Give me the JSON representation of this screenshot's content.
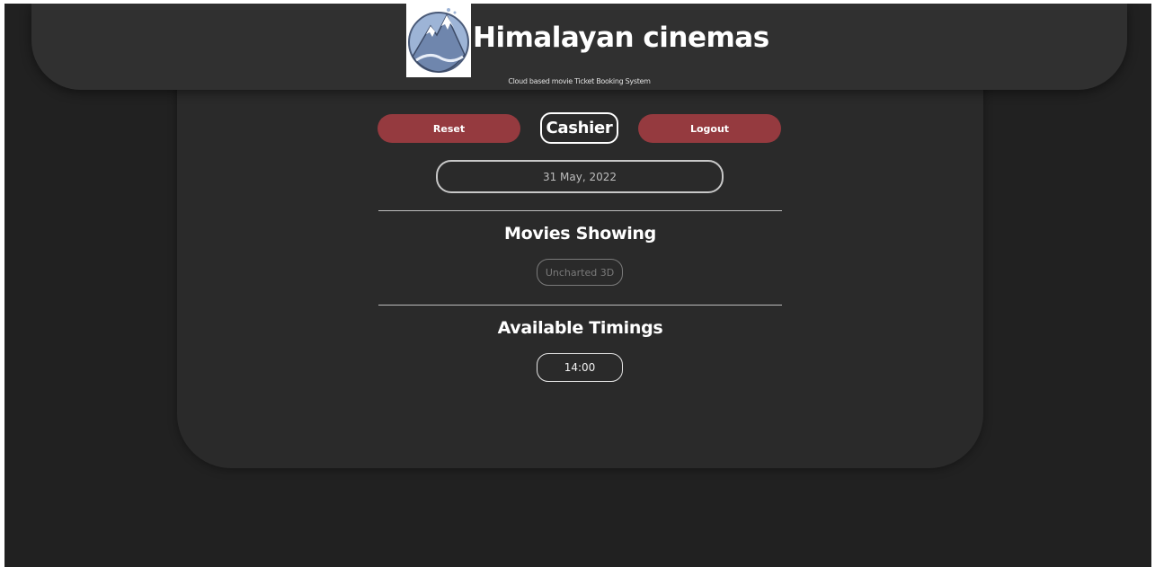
{
  "header": {
    "title": "Himalayan cinemas",
    "subtitle": "Cloud based movie Ticket Booking System",
    "logo_icon": "mountain-logo-icon"
  },
  "toolbar": {
    "reset_label": "Reset",
    "role_label": "Cashier",
    "logout_label": "Logout"
  },
  "date_picker": {
    "value": "31 May, 2022"
  },
  "movies": {
    "heading": "Movies Showing",
    "items": [
      "Uncharted 3D"
    ]
  },
  "timings": {
    "heading": "Available Timings",
    "items": [
      "14:00"
    ]
  },
  "colors": {
    "background": "#212121",
    "card": "#2a2a2a",
    "header": "#303030",
    "accent_red": "#953a3f"
  }
}
